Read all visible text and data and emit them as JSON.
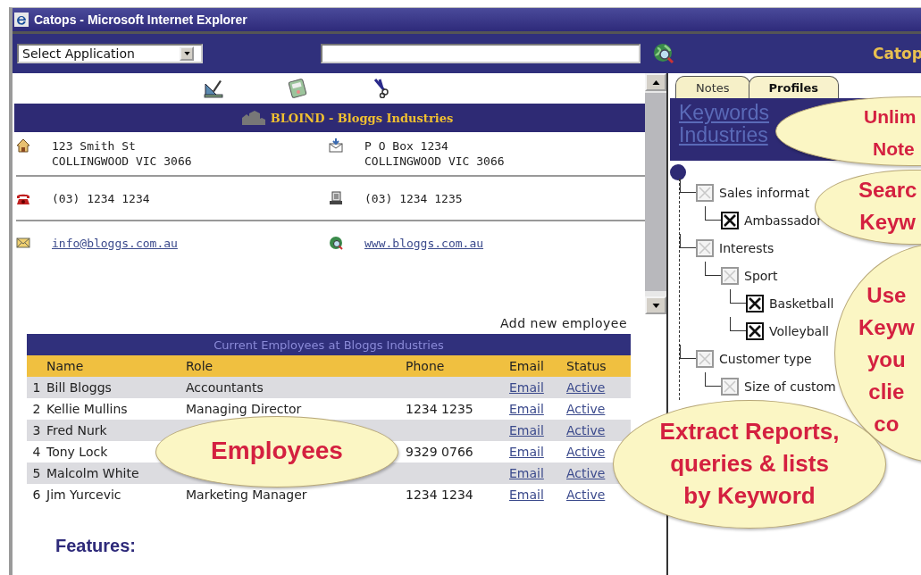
{
  "window": {
    "title": "Catops - Microsoft Internet Explorer"
  },
  "toolbar": {
    "application_select": {
      "value": "Select Application"
    },
    "brand": "Catop"
  },
  "company": {
    "banner": "BLOIND - Bloggs Industries",
    "street_address": [
      "123 Smith St",
      "COLLINGWOOD VIC 3066"
    ],
    "postal_address": [
      "P O Box 1234",
      "COLLINGWOOD VIC 3066"
    ],
    "phone": "(03) 1234 1234",
    "fax": "(03) 1234 1235",
    "email": "info@bloggs.com.au",
    "website": "www.bloggs.com.au"
  },
  "add_employee": "Add new employee",
  "employees": {
    "title": "Current Employees at Bloggs Industries",
    "columns": [
      "Name",
      "Role",
      "Phone",
      "Email",
      "Status"
    ],
    "rows": [
      {
        "number": "1",
        "name": "Bill Bloggs",
        "role": "Accountants",
        "email": "Email",
        "status": "Active"
      },
      {
        "number": "2",
        "name": "Kellie Mullins",
        "role": "Managing Director",
        "phone": "1234 1235",
        "email": "Email",
        "status": "Active"
      },
      {
        "number": "3",
        "name": "Fred Nurk",
        "email": "Email",
        "status": "Active"
      },
      {
        "number": "4",
        "name": "Tony Lock",
        "phone": "9329 0766",
        "email": "Email",
        "status": "Active"
      },
      {
        "number": "5",
        "name": "Malcolm White",
        "email": "Email",
        "status": "Active"
      },
      {
        "number": "6",
        "name": "Jim Yurcevic",
        "role": "Marketing Manager",
        "phone": "1234 1234",
        "email": "Email",
        "status": "Active"
      }
    ]
  },
  "features_heading": "Features:",
  "tabs": [
    {
      "label": "Notes",
      "selected": false
    },
    {
      "label": "Profiles",
      "selected": true
    }
  ],
  "keywords_heading": [
    "Keywords",
    "Industries"
  ],
  "keyword_tree": [
    {
      "label": "Sales informat",
      "checked": false,
      "children": [
        {
          "label": "Ambassador",
          "checked": true
        }
      ]
    },
    {
      "label": "Interests",
      "checked": false,
      "children": [
        {
          "label": "Sport",
          "checked": false,
          "children": [
            {
              "label": "Basketball",
              "checked": true
            },
            {
              "label": "Volleyball",
              "checked": true
            }
          ]
        }
      ]
    },
    {
      "label": "Customer type",
      "checked": false,
      "children": [
        {
          "label": "Size of custom",
          "checked": false
        }
      ]
    }
  ],
  "callouts": [
    {
      "lines": [
        "Unlim",
        "Note"
      ]
    },
    {
      "lines": [
        "Searc",
        "Keyw"
      ]
    },
    {
      "lines": [
        "Use",
        "Keyw",
        "you",
        "clie",
        "co"
      ]
    },
    {
      "lines": [
        "Employees"
      ]
    },
    {
      "lines": [
        "Extract Reports,",
        "queries & lists",
        "by Keyword"
      ]
    }
  ]
}
